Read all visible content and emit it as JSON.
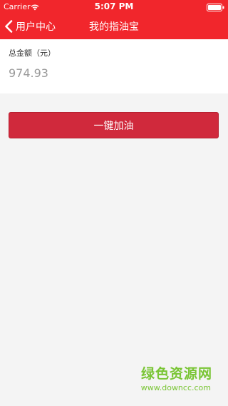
{
  "status_bar": {
    "carrier": "Carrier",
    "time": "5:07 PM"
  },
  "nav": {
    "back_label": "用户中心",
    "title": "我的指油宝"
  },
  "amount": {
    "label": "总金额（元）",
    "value": "974.93"
  },
  "actions": {
    "refuel_label": "一键加油"
  },
  "watermark": {
    "title": "绿色资源网",
    "url": "www.downcc.com"
  },
  "colors": {
    "header": "#f1262c",
    "button": "#d0293c",
    "background": "#f4f4f4",
    "watermark": "#79c534"
  }
}
